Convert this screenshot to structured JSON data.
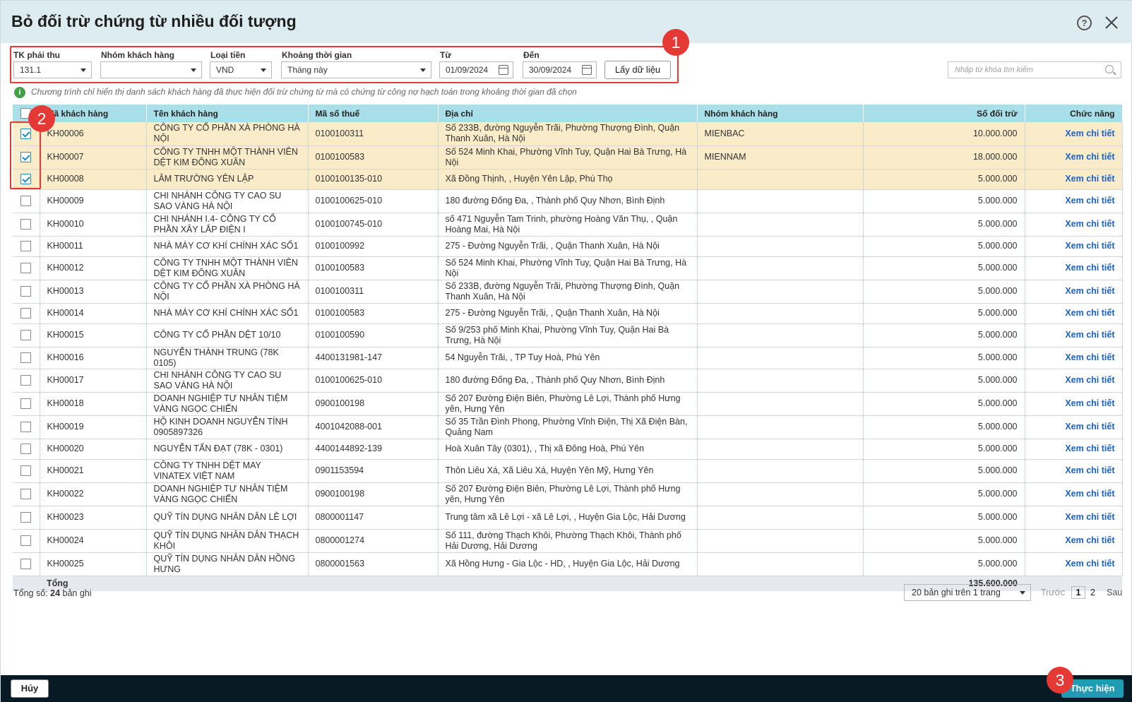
{
  "dialog": {
    "title": "Bỏ đối trừ chứng từ nhiều đối tượng"
  },
  "filters": {
    "account": {
      "label": "TK phải thu",
      "value": "131.1"
    },
    "customer_group": {
      "label": "Nhóm khách hàng",
      "value": ""
    },
    "currency": {
      "label": "Loại tiền",
      "value": "VND"
    },
    "period": {
      "label": "Khoảng thời gian",
      "value": "Tháng này"
    },
    "from": {
      "label": "Từ",
      "value": "01/09/2024"
    },
    "to": {
      "label": "Đến",
      "value": "30/09/2024"
    },
    "get_data_label": "Lấy dữ liệu"
  },
  "search": {
    "placeholder": "Nhập từ khóa tìm kiếm"
  },
  "info_text": "Chương trình chỉ hiển thị danh sách khách hàng đã thực hiện đối trừ chứng từ mà có chứng từ công nợ hạch toán trong khoảng thời gian đã chọn",
  "table": {
    "columns": [
      "Mã khách hàng",
      "Tên khách hàng",
      "Mã số thuế",
      "Địa chỉ",
      "Nhóm khách hàng",
      "Số đối trừ",
      "Chức năng"
    ],
    "rows": [
      {
        "checked": true,
        "code": "KH00006",
        "name": "CÔNG TY CỔ PHẦN XÀ PHÒNG HÀ NỘI",
        "tax": "0100100311",
        "address": "Số 233B, đường Nguyễn Trãi, Phường Thượng Đình, Quận Thanh Xuân, Hà Nội",
        "group": "MIENBAC",
        "amount": "10.000.000",
        "action": "Xem chi tiết"
      },
      {
        "checked": true,
        "code": "KH00007",
        "name": "CÔNG TY TNHH MỘT THÀNH VIÊN DỆT KIM ĐÔNG XUÂN",
        "tax": "0100100583",
        "address": "Số 524 Minh Khai, Phường Vĩnh Tuy, Quận Hai Bà Trưng, Hà Nội",
        "group": "MIENNAM",
        "amount": "18.000.000",
        "action": "Xem chi tiết"
      },
      {
        "checked": true,
        "code": "KH00008",
        "name": "LÂM TRƯỜNG YÊN LẬP",
        "tax": "0100100135-010",
        "address": "Xã Đồng Thịnh, , Huyện Yên Lập, Phú Thọ",
        "group": "",
        "amount": "5.000.000",
        "action": "Xem chi tiết"
      },
      {
        "checked": false,
        "code": "KH00009",
        "name": "CHI NHÁNH CÔNG TY CAO SU SAO VÀNG HÀ NỘI",
        "tax": "0100100625-010",
        "address": "180 đường Đống Đa, , Thành phố Quy Nhơn, Bình Định",
        "group": "",
        "amount": "5.000.000",
        "action": "Xem chi tiết"
      },
      {
        "checked": false,
        "code": "KH00010",
        "name": "CHI NHÁNH I.4- CÔNG TY CỔ PHẦN XÂY LẮP ĐIỆN I",
        "tax": "0100100745-010",
        "address": "số 471 Nguyễn Tam Trinh, phường Hoàng Văn Thụ, , Quận Hoàng Mai, Hà Nội",
        "group": "",
        "amount": "5.000.000",
        "action": "Xem chi tiết"
      },
      {
        "checked": false,
        "code": "KH00011",
        "name": "NHÀ MÁY CƠ KHÍ CHÍNH XÁC SỐ1",
        "tax": "0100100992",
        "address": "275 - Đường Nguyễn Trãi, , Quận Thanh Xuân, Hà Nội",
        "group": "",
        "amount": "5.000.000",
        "action": "Xem chi tiết"
      },
      {
        "checked": false,
        "code": "KH00012",
        "name": "CÔNG TY TNHH MỘT THÀNH VIÊN DỆT KIM ĐÔNG XUÂN",
        "tax": "0100100583",
        "address": "Số 524 Minh Khai, Phường Vĩnh Tuy, Quận Hai Bà Trưng, Hà Nội",
        "group": "",
        "amount": "5.000.000",
        "action": "Xem chi tiết"
      },
      {
        "checked": false,
        "code": "KH00013",
        "name": "CÔNG TY CỔ PHẦN XÀ PHÒNG HÀ NỘI",
        "tax": "0100100311",
        "address": "Số 233B, đường Nguyễn Trãi, Phường Thượng Đình, Quận Thanh Xuân, Hà Nội",
        "group": "",
        "amount": "5.000.000",
        "action": "Xem chi tiết"
      },
      {
        "checked": false,
        "code": "KH00014",
        "name": "NHÀ MÁY CƠ KHÍ CHÍNH XÁC SỐ1",
        "tax": "0100100583",
        "address": "275 - Đường Nguyễn Trãi, , Quận Thanh Xuân, Hà Nội",
        "group": "",
        "amount": "5.000.000",
        "action": "Xem chi tiết"
      },
      {
        "checked": false,
        "code": "KH00015",
        "name": "CÔNG TY CỔ PHẦN DỆT 10/10",
        "tax": "0100100590",
        "address": "Số 9/253 phố Minh Khai, Phường Vĩnh Tuy, Quận Hai Bà Trưng, Hà Nội",
        "group": "",
        "amount": "5.000.000",
        "action": "Xem chi tiết"
      },
      {
        "checked": false,
        "code": "KH00016",
        "name": "NGUYỄN THÀNH TRUNG (78K 0105)",
        "tax": "4400131981-147",
        "address": "54 Nguyễn Trãi, , TP Tuy Hoà, Phú Yên",
        "group": "",
        "amount": "5.000.000",
        "action": "Xem chi tiết"
      },
      {
        "checked": false,
        "code": "KH00017",
        "name": "CHI NHÁNH CÔNG TY CAO SU SAO VÀNG HÀ NỘI",
        "tax": "0100100625-010",
        "address": "180 đường Đống Đa, , Thành phố Quy Nhơn, Bình Định",
        "group": "",
        "amount": "5.000.000",
        "action": "Xem chi tiết"
      },
      {
        "checked": false,
        "code": "KH00018",
        "name": "DOANH NGHIỆP TƯ NHÂN TIỆM VÀNG NGỌC CHIẾN",
        "tax": "0900100198",
        "address": "Số 207 Đường Điện Biên, Phường Lê Lợi, Thành phố Hưng yên, Hưng Yên",
        "group": "",
        "amount": "5.000.000",
        "action": "Xem chi tiết"
      },
      {
        "checked": false,
        "code": "KH00019",
        "name": "HỘ KINH DOANH NGUYỄN TÍNH 0905897326",
        "tax": "4001042088-001",
        "address": "Số 35 Trần Đình Phong, Phường Vĩnh Điện, Thị Xã Điện Bàn, Quảng Nam",
        "group": "",
        "amount": "5.000.000",
        "action": "Xem chi tiết"
      },
      {
        "checked": false,
        "code": "KH00020",
        "name": "NGUYỄN TẤN ĐẠT (78K - 0301)",
        "tax": "4400144892-139",
        "address": "Hoà Xuân Tây (0301), , Thị xã Đông Hoà, Phú Yên",
        "group": "",
        "amount": "5.000.000",
        "action": "Xem chi tiết"
      },
      {
        "checked": false,
        "code": "KH00021",
        "name": "CÔNG TY TNHH DỆT MAY VINATEX VIỆT NAM",
        "tax": "0901153594",
        "address": "Thôn Liêu Xá, Xã Liêu Xá, Huyện Yên Mỹ, Hưng Yên",
        "group": "",
        "amount": "5.000.000",
        "action": "Xem chi tiết"
      },
      {
        "checked": false,
        "code": "KH00022",
        "name": "DOANH NGHIỆP TƯ NHÂN TIỆM VÀNG NGỌC CHIẾN",
        "tax": "0900100198",
        "address": "Số 207 Đường Điện Biên, Phường Lê Lợi, Thành phố Hưng yên, Hưng Yên",
        "group": "",
        "amount": "5.000.000",
        "action": "Xem chi tiết"
      },
      {
        "checked": false,
        "code": "KH00023",
        "name": "QUỸ TÍN DỤNG NHÂN DÂN LÊ LỢI",
        "tax": "0800001147",
        "address": "Trung tâm xã Lê Lợi - xã Lê Lợi, , Huyện Gia Lộc, Hải Dương",
        "group": "",
        "amount": "5.000.000",
        "action": "Xem chi tiết"
      },
      {
        "checked": false,
        "code": "KH00024",
        "name": "QUỸ TÍN DỤNG NHÂN DÂN THẠCH KHÔI",
        "tax": "0800001274",
        "address": "Số 111, đường Thạch Khôi, Phường Thạch Khôi, Thành phố Hải Dương, Hải Dương",
        "group": "",
        "amount": "5.000.000",
        "action": "Xem chi tiết"
      },
      {
        "checked": false,
        "code": "KH00025",
        "name": "QUỸ TÍN DỤNG NHÂN DÂN HỒNG HƯNG",
        "tax": "0800001563",
        "address": "Xã Hồng Hưng - Gia Lộc - HD, , Huyện Gia Lộc, Hải Dương",
        "group": "",
        "amount": "5.000.000",
        "action": "Xem chi tiết"
      }
    ],
    "total_label": "Tổng",
    "total_amount": "135.600.000"
  },
  "footer_info": {
    "total_prefix": "Tổng số:",
    "total_count": "24",
    "total_suffix": "bản ghi"
  },
  "pagination": {
    "page_size": "20 bản ghi trên 1 trang",
    "prev": "Trước",
    "pages": [
      "1",
      "2"
    ],
    "current": "1",
    "next": "Sau"
  },
  "buttons": {
    "cancel": "Hủy",
    "execute": "Thực hiện"
  },
  "badges": [
    "1",
    "2",
    "3"
  ],
  "colors": {
    "header_bg": "#dcecf0",
    "table_header": "#a9dfe8",
    "selected_row": "#fbecc9",
    "link": "#1a62c6",
    "footer_bg": "#081a24",
    "primary_button": "#1f9bb3",
    "highlight": "#e53935"
  }
}
